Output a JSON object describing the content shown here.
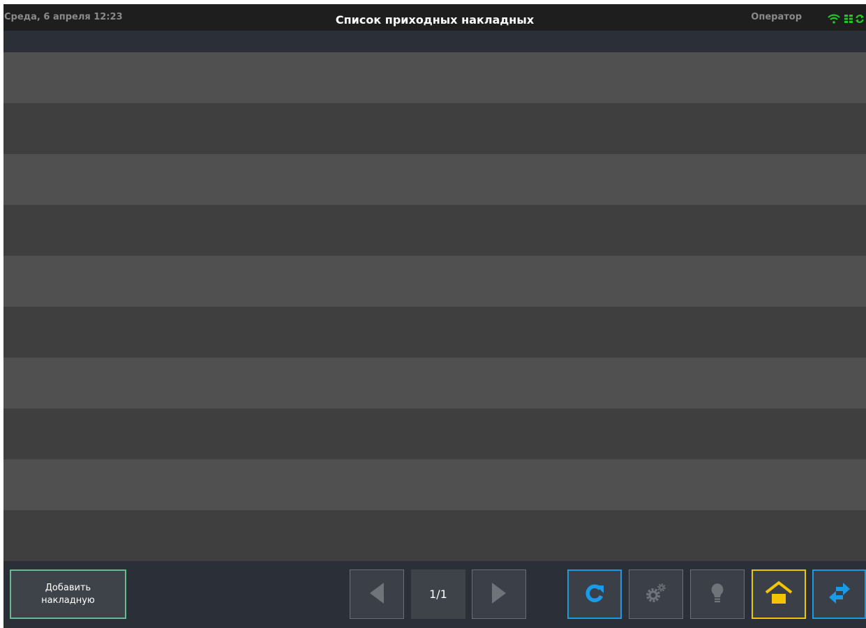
{
  "header": {
    "datetime": "Среда, 6 апреля 12:23",
    "title": "Список приходных накладных",
    "user": "Оператор",
    "status_icons": [
      "wifi-icon",
      "server-icon",
      "sync-icon"
    ],
    "status_color": "#1ecb1e"
  },
  "list": {
    "rows": [
      "",
      "",
      "",
      "",
      "",
      "",
      "",
      "",
      "",
      ""
    ]
  },
  "footer": {
    "add_line1": "Добавить",
    "add_line2": "накладную",
    "page": "1/1",
    "colors": {
      "accent_blue": "#1a9be8",
      "home_yellow": "#f2c500",
      "add_border": "#5fbf8f",
      "disabled": "#6a6f77"
    },
    "icons": [
      "prev-arrow-icon",
      "next-arrow-icon",
      "refresh-icon",
      "gears-icon",
      "lightbulb-icon",
      "home-icon",
      "swap-icon"
    ]
  }
}
